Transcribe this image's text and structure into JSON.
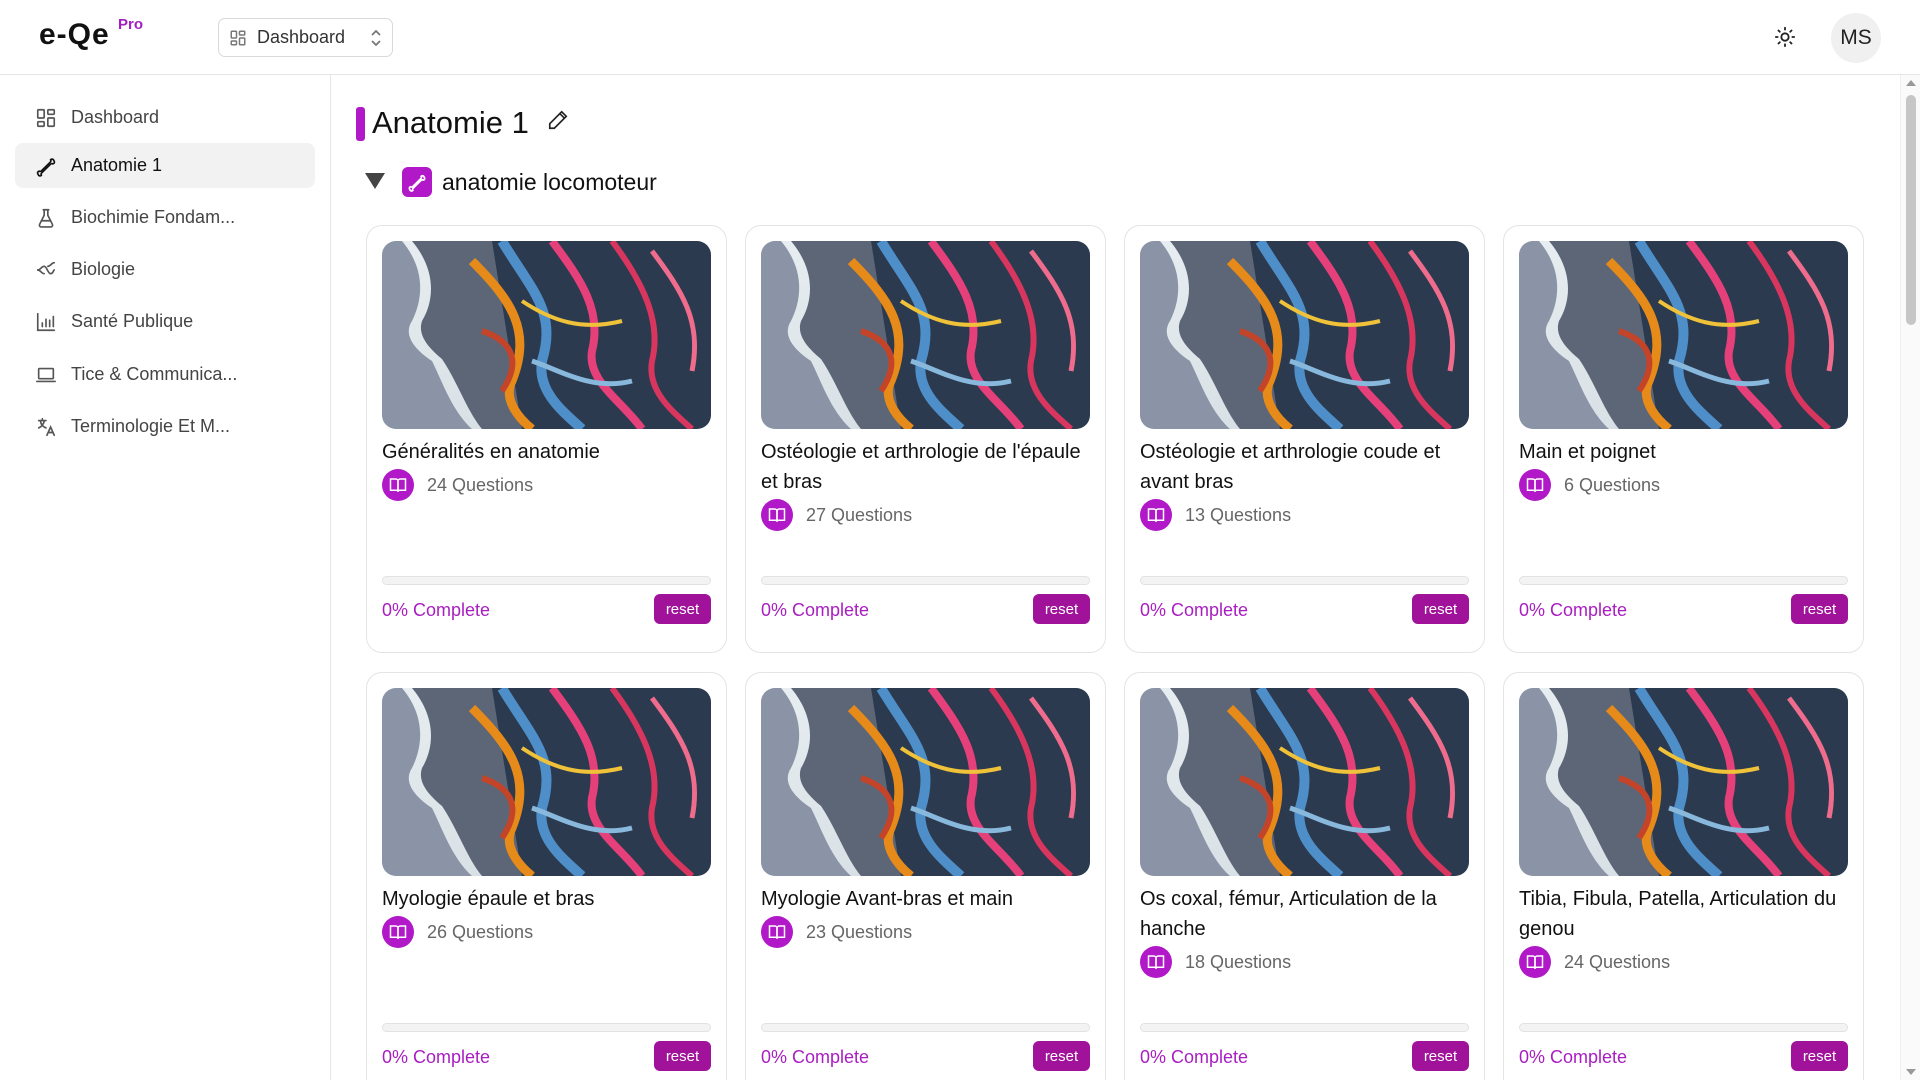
{
  "header": {
    "logo": "e-Qe",
    "logo_badge": "Pro",
    "selector_label": "Dashboard",
    "avatar_initials": "MS"
  },
  "sidebar": {
    "items": [
      {
        "label": "Dashboard",
        "icon": "dashboard-icon"
      },
      {
        "label": "Anatomie 1",
        "icon": "bone-icon",
        "active": true
      },
      {
        "label": "Biochimie Fondam...",
        "icon": "flask-icon"
      },
      {
        "label": "Biologie",
        "icon": "dna-icon"
      },
      {
        "label": "Santé Publique",
        "icon": "bar-chart-icon"
      },
      {
        "label": "Tice & Communica...",
        "icon": "laptop-icon"
      },
      {
        "label": "Terminologie Et M...",
        "icon": "translate-icon"
      }
    ]
  },
  "main": {
    "title": "Anatomie 1",
    "section": {
      "title": "anatomie locomoteur",
      "cards": [
        {
          "title": "Généralités en anatomie",
          "questions": "24 Questions",
          "progress": 0,
          "complete": "0% Complete",
          "reset": "reset"
        },
        {
          "title": "Ostéologie et arthrologie de l'épaule et bras",
          "questions": "27 Questions",
          "progress": 0,
          "complete": "0% Complete",
          "reset": "reset"
        },
        {
          "title": "Ostéologie et arthrologie coude et avant bras",
          "questions": "13 Questions",
          "progress": 0,
          "complete": "0% Complete",
          "reset": "reset"
        },
        {
          "title": "Main et poignet",
          "questions": "6 Questions",
          "progress": 0,
          "complete": "0% Complete",
          "reset": "reset"
        },
        {
          "title": "Myologie épaule et bras",
          "questions": "26 Questions",
          "progress": 0,
          "complete": "0% Complete",
          "reset": "reset"
        },
        {
          "title": "Myologie Avant-bras et main",
          "questions": "23 Questions",
          "progress": 0,
          "complete": "0% Complete",
          "reset": "reset"
        },
        {
          "title": "Os coxal, fémur, Articulation de la hanche",
          "questions": "18 Questions",
          "progress": 0,
          "complete": "0% Complete",
          "reset": "reset"
        },
        {
          "title": "Tibia, Fibula, Patella, Articulation du genou",
          "questions": "24 Questions",
          "progress": 0,
          "complete": "0% Complete",
          "reset": "reset"
        }
      ]
    }
  },
  "colors": {
    "accent": "#b018c8",
    "reset_button": "#a0129a"
  }
}
